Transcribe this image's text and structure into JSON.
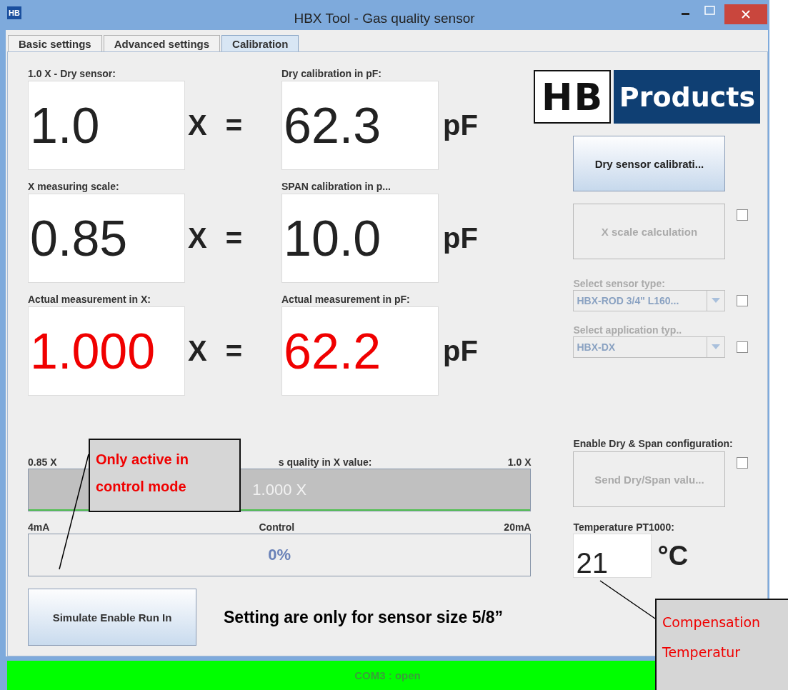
{
  "window": {
    "title": "HBX Tool - Gas quality sensor",
    "app_icon": "HB"
  },
  "tabs": [
    {
      "label": "Basic settings",
      "selected": false
    },
    {
      "label": "Advanced settings",
      "selected": false
    },
    {
      "label": "Calibration",
      "selected": true
    }
  ],
  "rows": [
    {
      "kind": "setting",
      "left_label": "1.0 X - Dry sensor:",
      "left_value": "1.0",
      "left_unit": "X",
      "equals": "=",
      "right_label": "Dry calibration in pF:",
      "right_value": "62.3",
      "right_unit": "pF"
    },
    {
      "kind": "setting",
      "left_label": "X measuring scale:",
      "left_value": "0.85",
      "left_unit": "X",
      "equals": "=",
      "right_label": "SPAN calibration in p...",
      "right_value": "10.0",
      "right_unit": "pF"
    },
    {
      "kind": "actual",
      "left_label": "Actual measurement in X:",
      "left_value": "1.000",
      "left_unit": "X",
      "equals": "=",
      "right_label": "Actual measurement in pF:",
      "right_value": "62.2",
      "right_unit": "pF"
    }
  ],
  "gauges": [
    {
      "min_label": "0.85 X",
      "title": "s quality in X value:",
      "max_label": "1.0 X",
      "reading": "1.000 X",
      "level": 1.0,
      "kind": "quality"
    },
    {
      "min_label": "4mA",
      "title": "Control",
      "max_label": "20mA",
      "reading": "0%",
      "level": 0,
      "kind": "control"
    }
  ],
  "simulate_button": "Simulate Enable Run In",
  "note": "Setting are only for sensor size 5/8”",
  "logo": {
    "left": "HB",
    "right": "Products"
  },
  "right_panel": {
    "dry_button": {
      "label": "Dry sensor calibrati...",
      "disabled": false
    },
    "xscale_button": {
      "label": "X scale calculation",
      "disabled": true
    },
    "xscale_checked": false,
    "sensor_label": "Select sensor type:",
    "sensor_value": "HBX-ROD 3/4\" L160...",
    "sensor_checked": false,
    "app_label": "Select application typ..",
    "app_value": "HBX-DX",
    "app_checked": false,
    "enable_label": "Enable Dry & Span configuration:",
    "send_button": {
      "label": "Send Dry/Span valu...",
      "disabled": true
    },
    "send_checked": false,
    "temp_label": "Temperature PT1000:",
    "temp_value": "21",
    "temp_unit": "°C"
  },
  "status_bar": "COM3 : open",
  "callouts": [
    {
      "lines": [
        "Only active in",
        "control mode"
      ],
      "kind": "top"
    },
    {
      "lines": [
        "Compensation",
        "Temperatur"
      ],
      "kind": "bottom"
    }
  ]
}
